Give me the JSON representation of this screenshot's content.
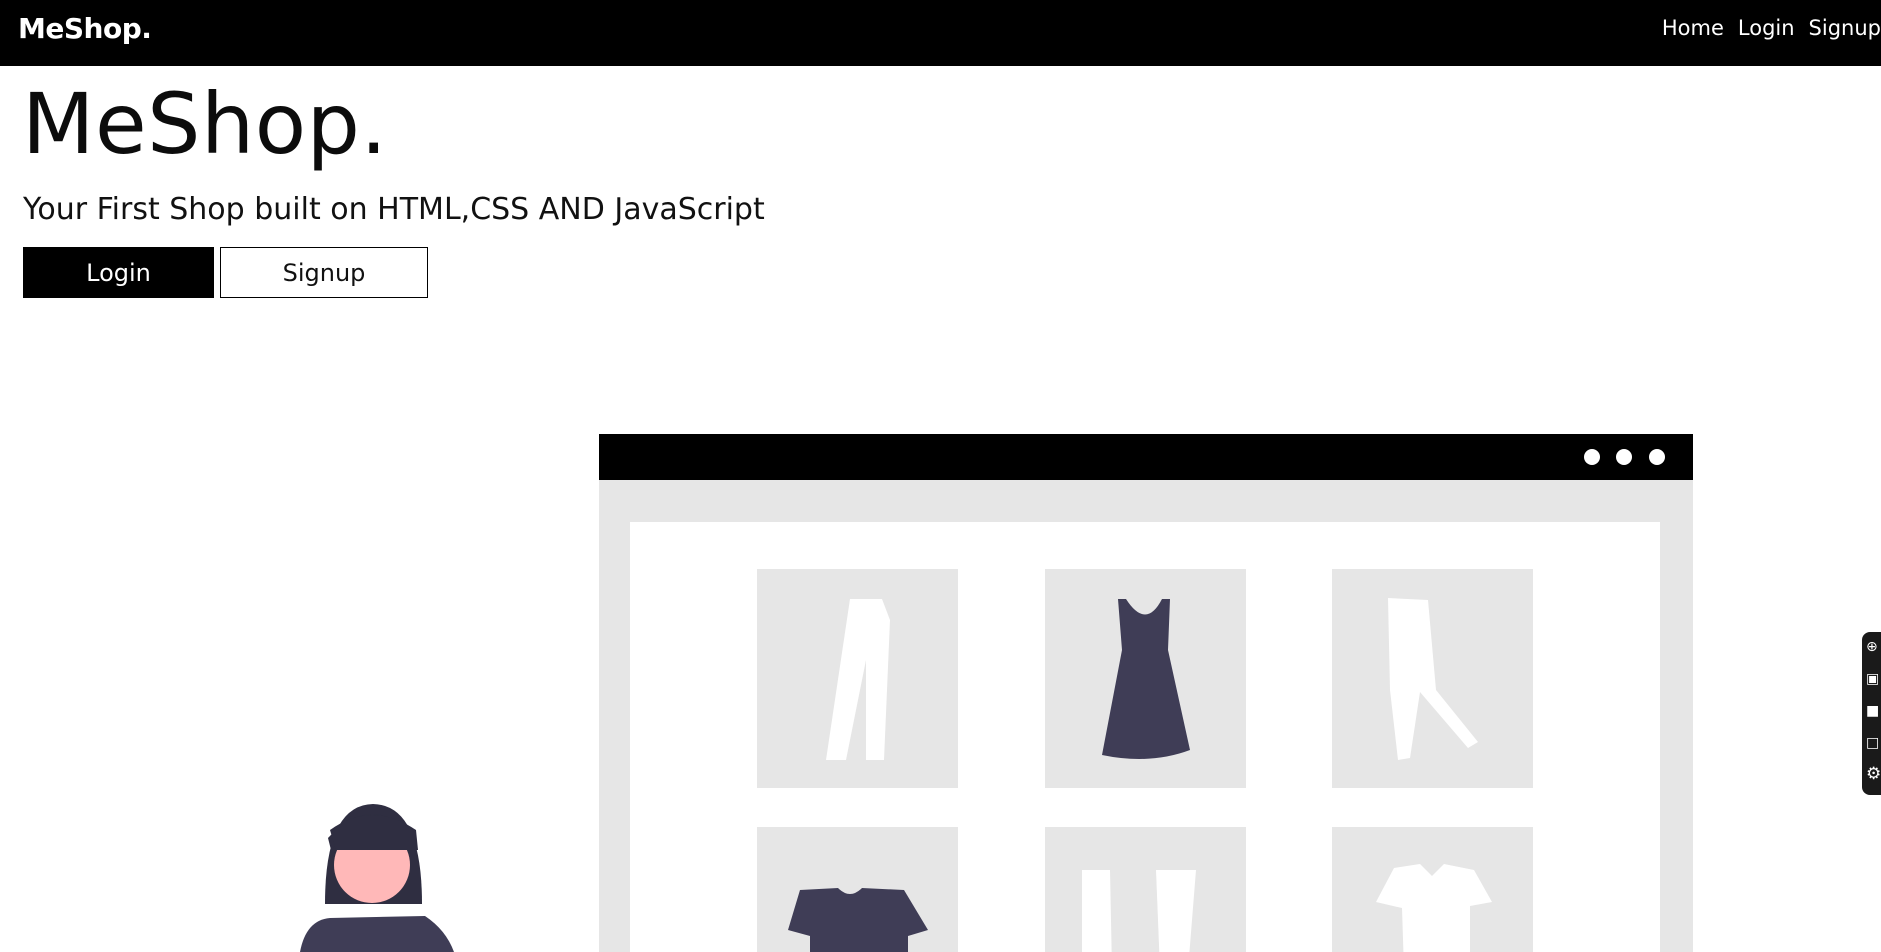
{
  "navbar": {
    "brand": "MeShop.",
    "links": [
      {
        "label": "Home"
      },
      {
        "label": "Login"
      },
      {
        "label": "Signup"
      }
    ]
  },
  "hero": {
    "title": "MeShop.",
    "subtitle": "Your First Shop built on HTML,CSS AND JavaScript",
    "login_label": "Login",
    "signup_label": "Signup"
  },
  "illustration": {
    "colors": {
      "browser_bar": "#000000",
      "browser_frame": "#e6e6e6",
      "product_tile": "#e6e6e6",
      "garment_dark": "#3f3d56",
      "garment_light": "#ffffff",
      "skin": "#ffb8b8",
      "hair": "#2f2e41"
    },
    "products": [
      "pants-icon",
      "dress-icon",
      "trousers-icon",
      "tshirt-icon",
      "pants-icon",
      "shirt-icon"
    ]
  },
  "side_dock": {
    "icons": [
      "link-icon",
      "camera-icon",
      "window-icon",
      "windows-icon",
      "gear-icon"
    ]
  }
}
